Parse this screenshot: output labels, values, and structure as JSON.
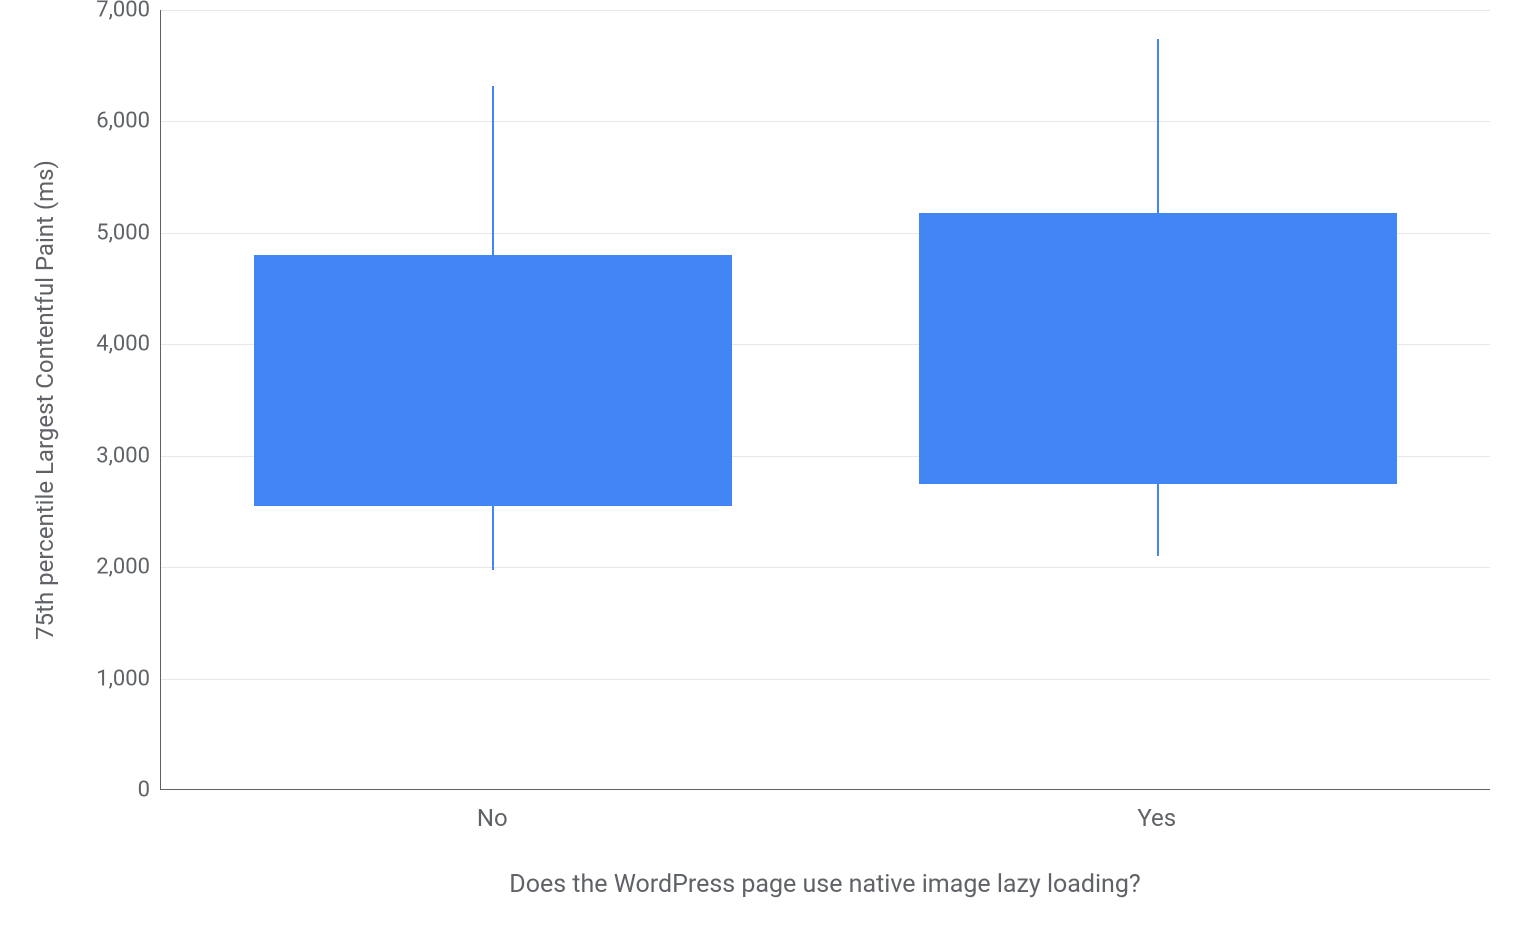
{
  "chart_data": {
    "type": "boxplot",
    "xlabel": "Does the WordPress page use native image lazy loading?",
    "ylabel": "75th percentile Largest Contentful Paint (ms)",
    "ylim": [
      0,
      7000
    ],
    "y_ticks": [
      {
        "value": 0,
        "label": "0"
      },
      {
        "value": 1000,
        "label": "1,000"
      },
      {
        "value": 2000,
        "label": "2,000"
      },
      {
        "value": 3000,
        "label": "3,000"
      },
      {
        "value": 4000,
        "label": "4,000"
      },
      {
        "value": 5000,
        "label": "5,000"
      },
      {
        "value": 6000,
        "label": "6,000"
      },
      {
        "value": 7000,
        "label": "7,000"
      }
    ],
    "categories": [
      "No",
      "Yes"
    ],
    "series": [
      {
        "category": "No",
        "whisker_low": 1970,
        "q1": 2550,
        "q3": 4800,
        "whisker_high": 6320
      },
      {
        "category": "Yes",
        "whisker_low": 2100,
        "q1": 2750,
        "q3": 5180,
        "whisker_high": 6740
      }
    ],
    "box_color": "#4285f4"
  }
}
